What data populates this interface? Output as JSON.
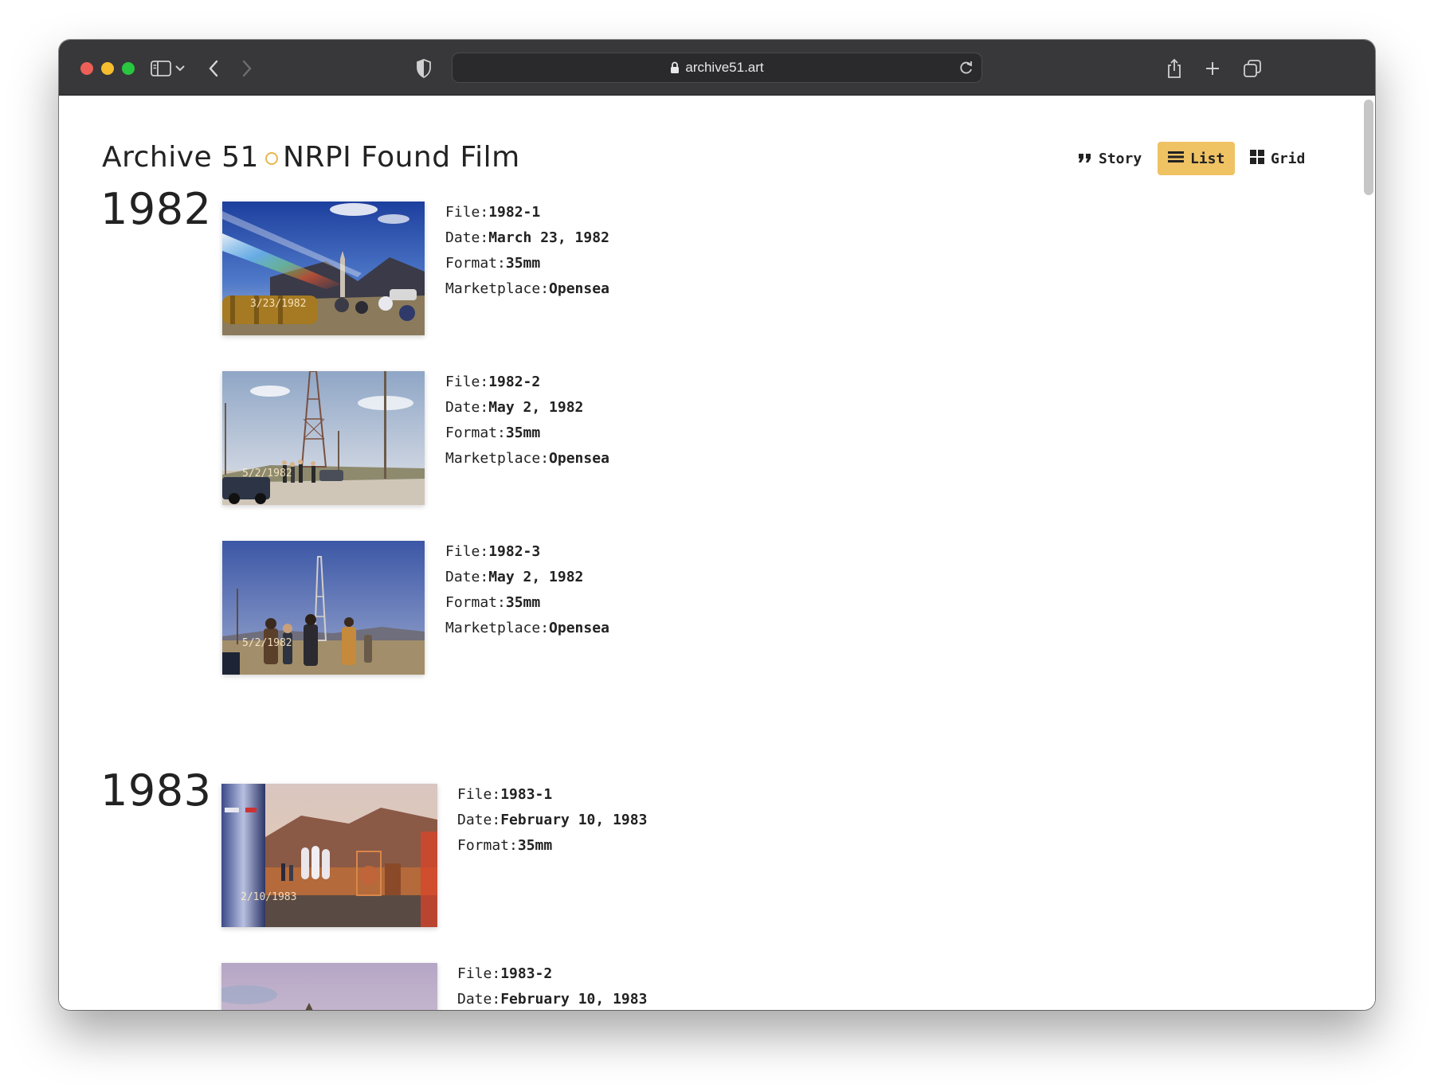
{
  "browser": {
    "url": "archive51.art"
  },
  "site": {
    "title_part1": "Archive 51",
    "title_part2": "NRPI Found Film"
  },
  "nav": {
    "story": "Story",
    "list": "List",
    "grid": "Grid",
    "active": "list"
  },
  "labels": {
    "file": "File:",
    "date": "Date:",
    "format": "Format:",
    "marketplace": "Marketplace:"
  },
  "years": [
    {
      "year": "1982",
      "entries": [
        {
          "file": "1982-1",
          "date": "March 23, 1982",
          "format": "35mm",
          "marketplace": "Opensea",
          "stamp": "3/23/1982"
        },
        {
          "file": "1982-2",
          "date": "May 2, 1982",
          "format": "35mm",
          "marketplace": "Opensea",
          "stamp": "5/2/1982"
        },
        {
          "file": "1982-3",
          "date": "May 2, 1982",
          "format": "35mm",
          "marketplace": "Opensea",
          "stamp": "5/2/1982"
        }
      ]
    },
    {
      "year": "1983",
      "entries": [
        {
          "file": "1983-1",
          "date": "February 10, 1983",
          "format": "35mm",
          "stamp": "2/10/1983"
        },
        {
          "file": "1983-2",
          "date": "February 10, 1983"
        }
      ]
    }
  ]
}
